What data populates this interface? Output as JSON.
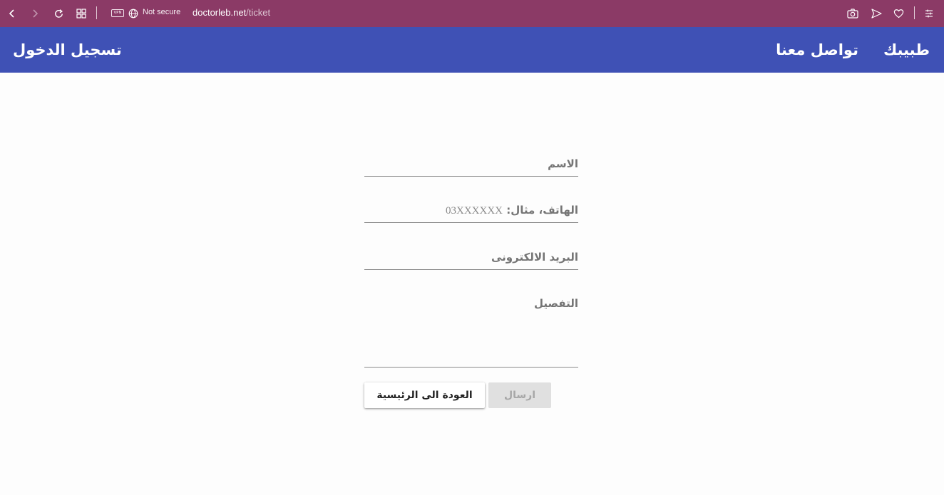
{
  "browser": {
    "status": "Not secure",
    "url_host": "doctorleb.net",
    "url_path": "/ticket",
    "vpn_badge": "VPN",
    "icons": [
      "back-icon",
      "forward-icon",
      "reload-icon",
      "tabs-grid-icon",
      "globe-icon",
      "camera-icon",
      "send-icon",
      "heart-icon",
      "menu-icon"
    ]
  },
  "appbar": {
    "brand": "طبيبك",
    "contact": "تواصل معنا",
    "login": "تسجيل الدخول",
    "color": "#3f51b5"
  },
  "form": {
    "name_label": "الاسم",
    "phone_label": "الهاتف، مثال:",
    "phone_hint": "03XXXXXX",
    "email_label": "البريد الالكترونى",
    "details_label": "التفصيل",
    "home_button": "العودة الى الرئيسية",
    "send_button": "ارسال"
  },
  "colors": {
    "chrome": "#8b3a66",
    "appbar": "#3f51b5",
    "disabled_button": "#e0e0e0"
  }
}
